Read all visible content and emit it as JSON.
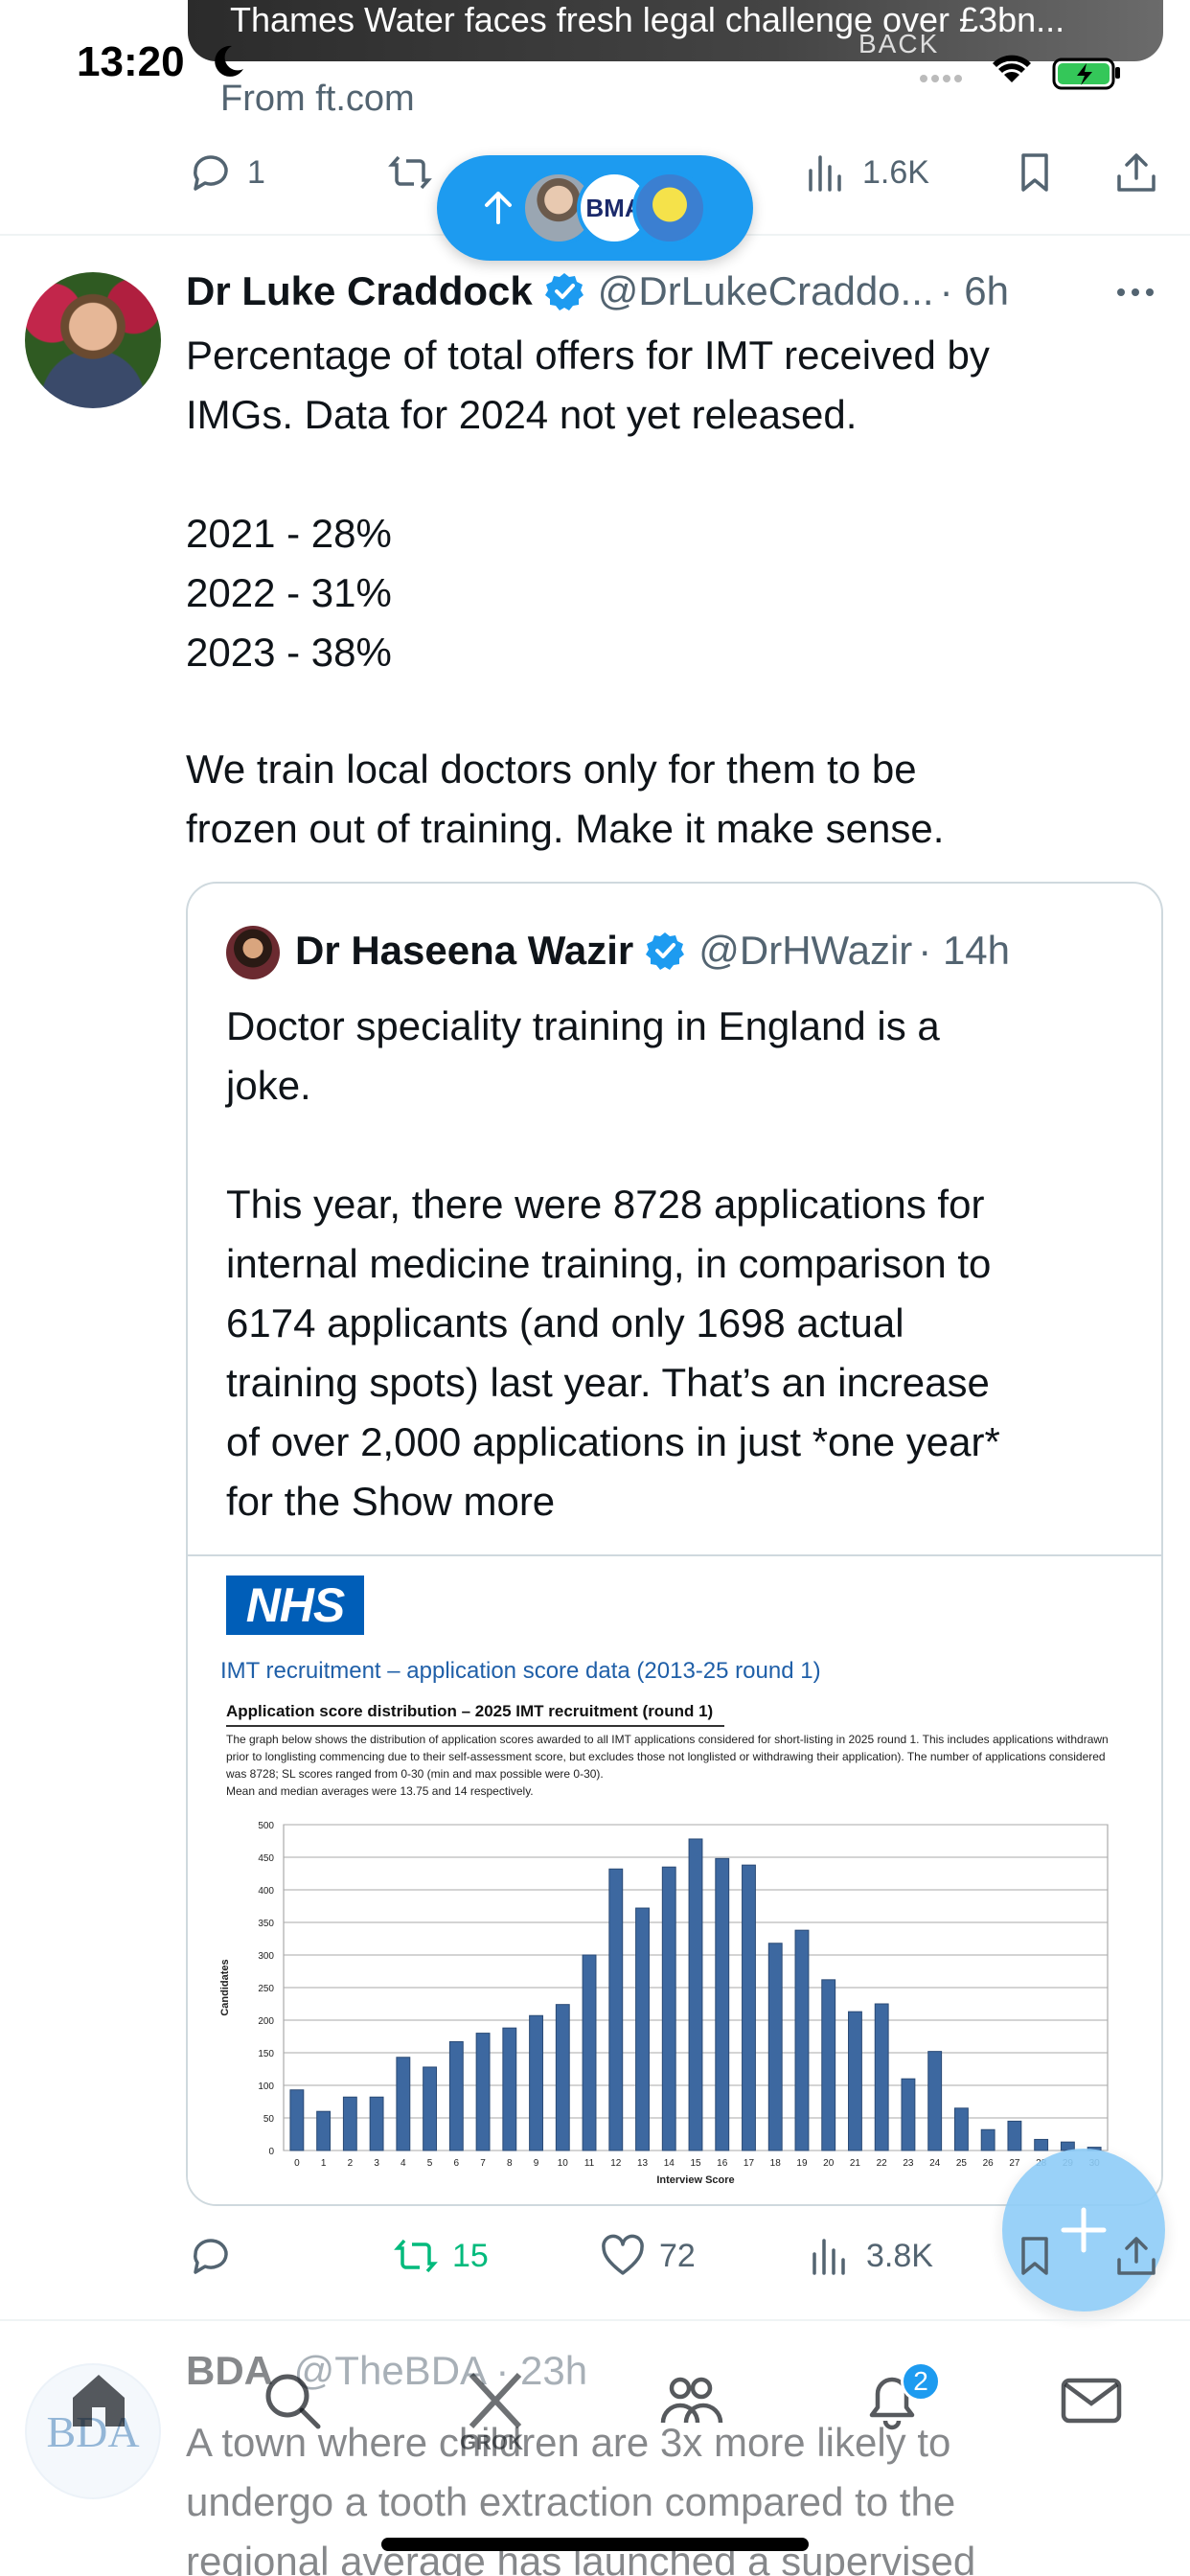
{
  "status_bar": {
    "time": "13:20",
    "dynamic_island_text": "Thames Water faces fresh legal challenge over £3bn...",
    "island_thumb_text": "BACK"
  },
  "prev_tweet": {
    "source": "From ft.com",
    "replies": "1",
    "views": "1.6K"
  },
  "new_posts_pill": {
    "avatar_text": "BMA"
  },
  "tweet": {
    "author": "Dr Luke Craddock",
    "handle": "@DrLukeCraddo...",
    "time": "· 6h",
    "lines": [
      "Percentage of total offers for IMT received by",
      "IMGs. Data for 2024 not yet released.",
      "2021 - 28%",
      "2022 - 31%",
      "2023 - 38%",
      "We train local doctors only for them to be",
      "frozen out of training. Make it make sense."
    ],
    "replies": "",
    "reposts": "15",
    "likes": "72",
    "views": "3.8K"
  },
  "quote": {
    "author": "Dr Haseena Wazir",
    "handle": "@DrHWazir",
    "time": "· 14h",
    "lines": [
      "Doctor speciality training in England is a",
      "joke.",
      "This year, there were 8728 applications for",
      "internal medicine training, in comparison to",
      "6174 applicants (and only 1698 actual",
      "training spots) last year. That’s an increase",
      "of over 2,000 applications in just *one year*",
      "for the "
    ],
    "show_more": "Show more",
    "media": {
      "logo": "NHS",
      "title": "IMT recruitment – application score data (2013-25 round 1)",
      "subtitle": "Application score distribution – 2025 IMT recruitment (round 1)",
      "description": "The graph below shows the distribution of application scores awarded to all IMT applications considered for short-listing in 2025 round 1. This includes applications withdrawn prior to longlisting commencing due to their self-assessment score, but excludes those not longlisted or withdrawing their application). The number of applications considered was 8728; SL scores ranged from 0-30 (min and max possible were 0-30).",
      "mean_text": "Mean and median averages were 13.75 and 14 respectively."
    }
  },
  "chart_data": {
    "type": "bar",
    "xlabel": "Interview Score",
    "ylabel": "Candidates",
    "ylim": [
      0,
      500
    ],
    "yticks": [
      0,
      50,
      100,
      150,
      200,
      250,
      300,
      350,
      400,
      450,
      500
    ],
    "grid": true,
    "categories": [
      "0",
      "1",
      "2",
      "3",
      "4",
      "5",
      "6",
      "7",
      "8",
      "9",
      "10",
      "11",
      "12",
      "13",
      "14",
      "15",
      "16",
      "17",
      "18",
      "19",
      "20",
      "21",
      "22",
      "23",
      "24",
      "25",
      "26",
      "27",
      "28",
      "29",
      "30"
    ],
    "values": [
      93,
      60,
      82,
      82,
      143,
      128,
      167,
      180,
      188,
      207,
      224,
      300,
      432,
      372,
      435,
      478,
      448,
      438,
      318,
      338,
      262,
      213,
      225,
      110,
      152,
      65,
      32,
      45,
      17,
      13,
      5
    ],
    "bar_color": "#3d68a0"
  },
  "next_tweet": {
    "avatar_text": "BDA",
    "author": "BDA",
    "handle": "@TheBDA · 23h",
    "lines": [
      "A town where children are 3x more likely to",
      "undergo a tooth extraction compared to the",
      "regional average has launched a supervised"
    ]
  },
  "tab_bar": {
    "grok_label": "GROK",
    "notifications_badge": "2"
  },
  "colors": {
    "accent": "#1d9bf0",
    "repost_green": "#00ba7c",
    "muted": "#536471",
    "nhs_blue": "#005eb8"
  }
}
